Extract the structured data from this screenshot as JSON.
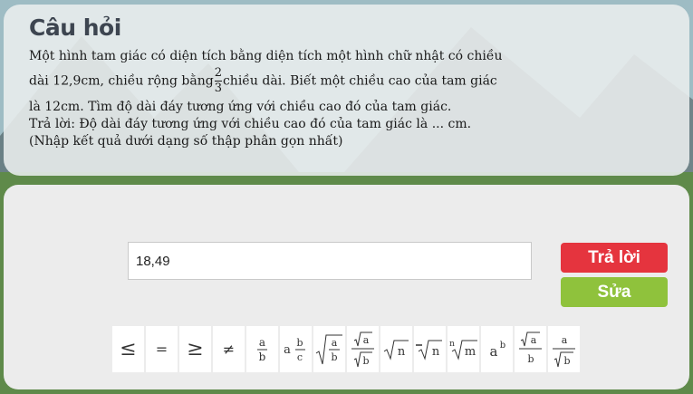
{
  "question": {
    "title": "Câu hỏi",
    "line1": "Một hình tam giác có diện tích bằng diện tích một hình chữ nhật có chiều",
    "line2_before": "dài 12,9cm, chiều rộng bằng",
    "fraction_numerator": "2",
    "fraction_denominator": "3",
    "line2_after": "chiều dài. Biết một chiều cao của tam giác",
    "line3": "là 12cm. Tìm độ dài đáy tương ứng với chiều cao đó của tam giác.",
    "line4": "Trả lời: Độ dài đáy tương ứng với chiều cao đó của tam giác là ... cm.",
    "line5": "(Nhập kết quả dưới dạng số thập phân gọn nhất)"
  },
  "answer": {
    "value": "18,49",
    "submit_label": "Trả lời",
    "edit_label": "Sửa"
  },
  "math_symbols": {
    "le": "≤",
    "eq": "=",
    "ge": "≥",
    "ne": "≠",
    "var_a": "a",
    "var_b": "b",
    "var_c": "c",
    "var_n": "n",
    "var_m": "m"
  },
  "colors": {
    "submit": "#e5343e",
    "edit": "#8fc23c"
  }
}
